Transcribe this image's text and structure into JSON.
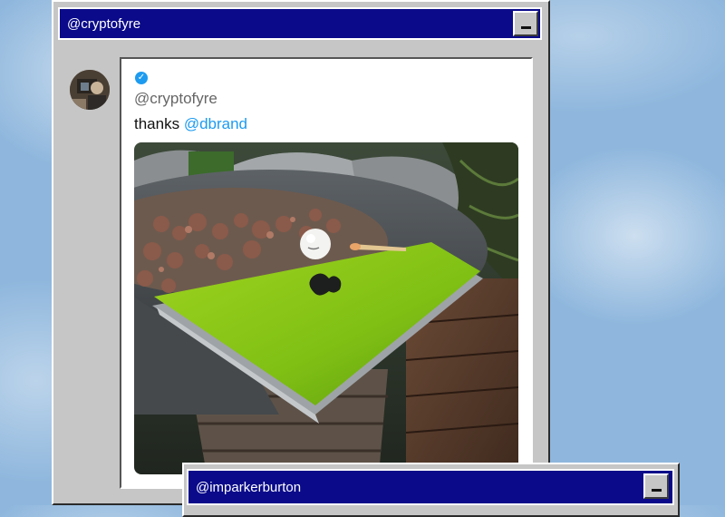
{
  "windows": [
    {
      "title": "@cryptofyre",
      "tweet": {
        "handle": "@cryptofyre",
        "text_prefix": "thanks ",
        "mention": "@dbrand",
        "verified": true
      }
    },
    {
      "title": "@imparkerburton"
    }
  ],
  "icons": {
    "minimize": "minimize-icon",
    "verified": "verified-badge-icon",
    "verified_glyph": "✓",
    "apple_logo": "apple-logo-icon"
  },
  "colors": {
    "titlebar": "#0a0a8a",
    "window_chrome": "#c6c6c6",
    "mention": "#1d9bf0",
    "sky": "#8fb7dd"
  }
}
